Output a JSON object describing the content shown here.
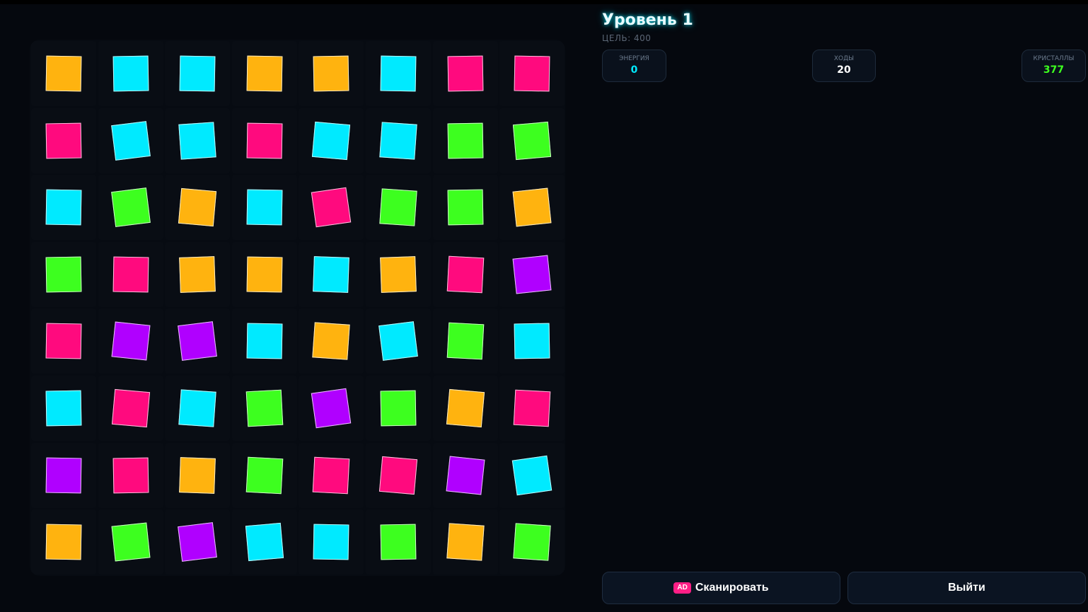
{
  "header": {
    "level_title": "Уровень 1",
    "goal_label": "ЦЕЛЬ: 400"
  },
  "stats": [
    {
      "label": "ЭНЕРГИЯ",
      "value": "0",
      "color": "#00eaff"
    },
    {
      "label": "ХОДЫ",
      "value": "20",
      "color": "#ffffff"
    },
    {
      "label": "КРИСТАЛЛЫ",
      "value": "377",
      "color": "#3dff1f"
    }
  ],
  "buttons": {
    "scan_badge": "AD",
    "scan_label": "Сканировать",
    "exit_label": "Выйти"
  },
  "colors": {
    "orange": "#ffb30f",
    "cyan": "#00eaff",
    "pink": "#ff0a7e",
    "green": "#3dff1f",
    "purple": "#b000ff"
  },
  "board": {
    "rows": 8,
    "cols": 8,
    "grid": [
      [
        "orange",
        "cyan",
        "cyan",
        "orange",
        "orange",
        "cyan",
        "pink",
        "pink"
      ],
      [
        "pink",
        "cyan",
        "cyan",
        "pink",
        "cyan",
        "cyan",
        "green",
        "green"
      ],
      [
        "cyan",
        "green",
        "orange",
        "cyan",
        "pink",
        "green",
        "green",
        "orange"
      ],
      [
        "green",
        "pink",
        "orange",
        "orange",
        "cyan",
        "orange",
        "pink",
        "purple"
      ],
      [
        "pink",
        "purple",
        "purple",
        "cyan",
        "orange",
        "cyan",
        "green",
        "cyan"
      ],
      [
        "cyan",
        "pink",
        "cyan",
        "green",
        "purple",
        "green",
        "orange",
        "pink"
      ],
      [
        "purple",
        "pink",
        "orange",
        "green",
        "pink",
        "pink",
        "purple",
        "cyan"
      ],
      [
        "orange",
        "green",
        "purple",
        "cyan",
        "cyan",
        "green",
        "orange",
        "green"
      ]
    ]
  }
}
